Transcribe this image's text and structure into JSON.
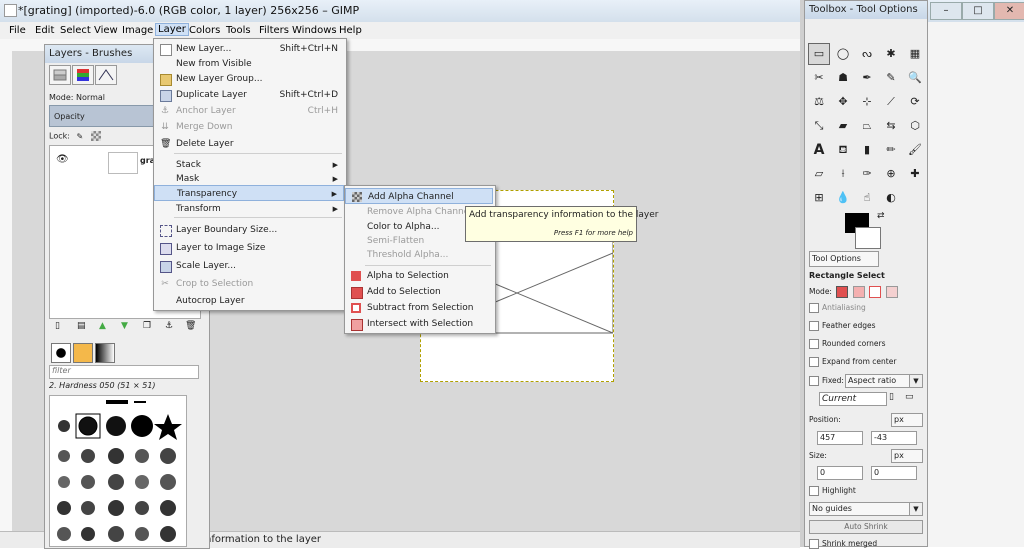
{
  "window": {
    "title": "*[grating] (imported)-6.0 (RGB color, 1 layer) 256x256 – GIMP",
    "controls": {
      "minimize": "–",
      "maximize": "□",
      "close": "✕"
    }
  },
  "menubar": {
    "items": [
      "File",
      "Edit",
      "Select",
      "View",
      "Image",
      "Layer",
      "Colors",
      "Tools",
      "Filters",
      "Windows",
      "Help"
    ]
  },
  "layers_dock": {
    "title": "Layers - Brushes",
    "mode_label": "Mode: Normal",
    "opacity_label": "Opacity",
    "lock_label": "Lock:",
    "layer_name": "grati",
    "brush_filter_placeholder": "filter",
    "brush_name": "2. Hardness 050 (51 × 51)"
  },
  "layer_menu": {
    "items": [
      {
        "label": "New Layer...",
        "shortcut": "Shift+Ctrl+N",
        "disabled": false
      },
      {
        "label": "New from Visible",
        "shortcut": "",
        "disabled": false
      },
      {
        "label": "New Layer Group...",
        "shortcut": "",
        "disabled": false
      },
      {
        "label": "Duplicate Layer",
        "shortcut": "Shift+Ctrl+D",
        "disabled": false
      },
      {
        "label": "Anchor Layer",
        "shortcut": "Ctrl+H",
        "disabled": true
      },
      {
        "label": "Merge Down",
        "shortcut": "",
        "disabled": true
      },
      {
        "label": "Delete Layer",
        "shortcut": "",
        "disabled": false
      },
      {
        "label": "Stack",
        "shortcut": "",
        "disabled": false
      },
      {
        "label": "Mask",
        "shortcut": "",
        "disabled": false
      },
      {
        "label": "Transparency",
        "shortcut": "",
        "disabled": false
      },
      {
        "label": "Transform",
        "shortcut": "",
        "disabled": false
      },
      {
        "label": "Layer Boundary Size...",
        "shortcut": "",
        "disabled": false
      },
      {
        "label": "Layer to Image Size",
        "shortcut": "",
        "disabled": false
      },
      {
        "label": "Scale Layer...",
        "shortcut": "",
        "disabled": false
      },
      {
        "label": "Crop to Selection",
        "shortcut": "",
        "disabled": true
      },
      {
        "label": "Autocrop Layer",
        "shortcut": "",
        "disabled": false
      }
    ]
  },
  "transparency_menu": {
    "items": [
      {
        "label": "Add Alpha Channel",
        "disabled": false
      },
      {
        "label": "Remove Alpha Channel",
        "disabled": true
      },
      {
        "label": "Color to Alpha...",
        "disabled": false
      },
      {
        "label": "Semi-Flatten",
        "disabled": true
      },
      {
        "label": "Threshold Alpha...",
        "disabled": true
      },
      {
        "label": "Alpha to Selection",
        "disabled": false
      },
      {
        "label": "Add to Selection",
        "disabled": false
      },
      {
        "label": "Subtract from Selection",
        "disabled": false
      },
      {
        "label": "Intersect with Selection",
        "disabled": false
      }
    ]
  },
  "tooltip": {
    "text": "Add transparency information to the layer",
    "help": "Press F1 for more help"
  },
  "status": {
    "text": "nformation to the layer"
  },
  "toolbox": {
    "title": "Toolbox - Tool Options",
    "tab_label": "Tool Options",
    "heading": "Rectangle Select",
    "mode_label": "Mode:",
    "options": {
      "antialiasing": "Antialiasing",
      "feather": "Feather edges",
      "rounded": "Rounded corners",
      "expand": "Expand from center",
      "fixed": "Fixed:",
      "fixed_value": "Aspect ratio",
      "current": "Current",
      "position_label": "Position:",
      "position_unit": "px",
      "pos_x": "457",
      "pos_y": "-43",
      "size_label": "Size:",
      "size_unit": "px",
      "size_w": "0",
      "size_h": "0",
      "highlight": "Highlight",
      "guides": "No guides",
      "auto_shrink": "Auto Shrink",
      "shrink_merged": "Shrink merged"
    }
  },
  "colors": {
    "menu_highlight": "#cfe0f5",
    "tooltip_bg": "#ffffe1",
    "canvas_bg": "#d8d8d8"
  }
}
